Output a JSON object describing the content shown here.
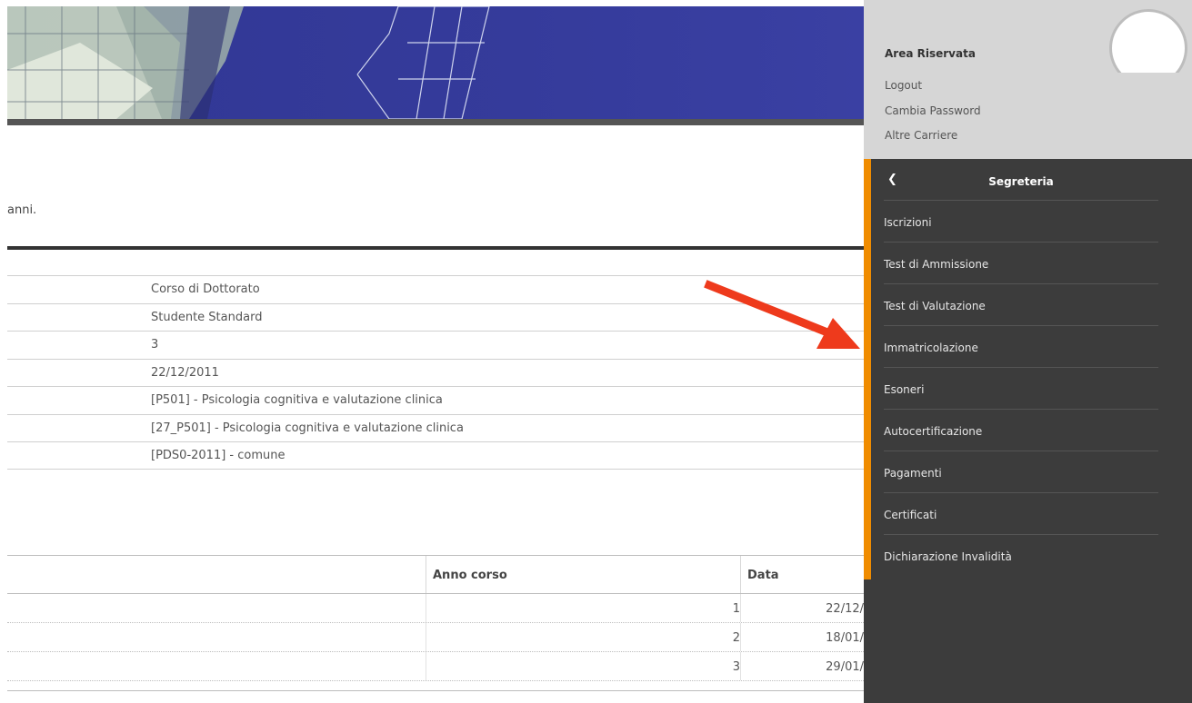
{
  "intro": {
    "text_fragment": "anni."
  },
  "career_info": {
    "values": [
      "Corso di Dottorato",
      "Studente Standard",
      "3",
      "22/12/2011",
      "[P501] - Psicologia cognitiva e valutazione clinica",
      "[27_P501] - Psicologia cognitiva e valutazione clinica",
      "[PDS0-2011] - comune"
    ]
  },
  "history_table": {
    "headers": {
      "anno_corso": "Anno corso",
      "data": "Data"
    },
    "rows": [
      {
        "anno": "1",
        "data": "22/12/"
      },
      {
        "anno": "2",
        "data": "18/01/"
      },
      {
        "anno": "3",
        "data": "29/01/"
      }
    ]
  },
  "user_area": {
    "title": "Area Riservata",
    "links": [
      "Logout",
      "Cambia Password",
      "Altre Carriere"
    ]
  },
  "menu": {
    "title": "Segreteria",
    "items": [
      "Iscrizioni",
      "Test di Ammissione",
      "Test di Valutazione",
      "Immatricolazione",
      "Esoneri",
      "Autocertificazione",
      "Pagamenti",
      "Certificati",
      "Dichiarazione Invalidità"
    ]
  },
  "colors": {
    "banner": "#353b9b",
    "sidebar": "#3c3c3c",
    "accent": "#f08c00",
    "arrow": "#ee3a1c"
  }
}
